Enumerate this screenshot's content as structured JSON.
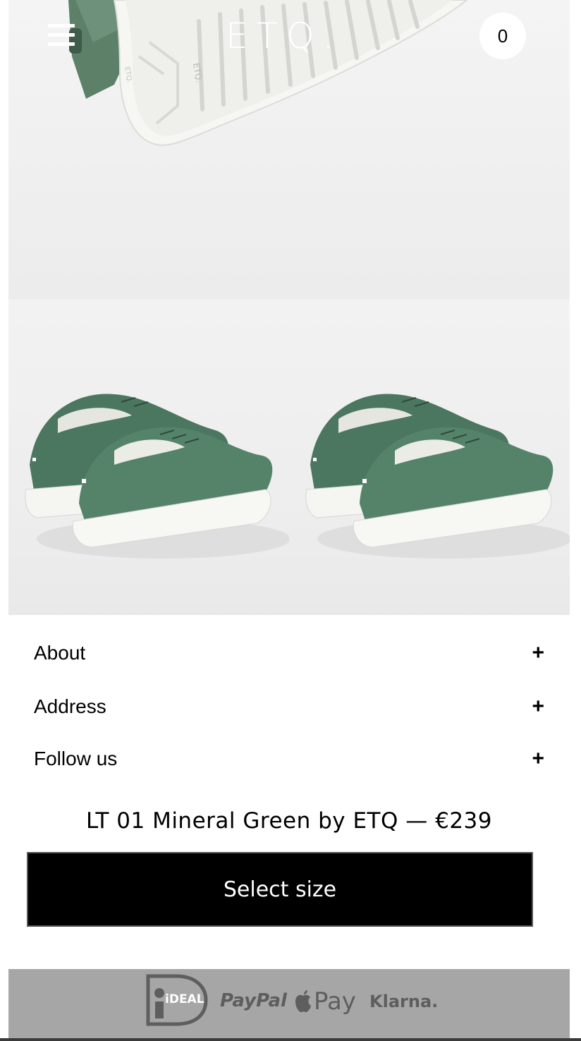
{
  "header": {
    "logo_text": "ETQ.",
    "cart_count": "0",
    "menu_icon": "hamburger-icon"
  },
  "gallery": {
    "hero_image": "shoe-sole-closeup",
    "thumbnails": [
      {
        "name": "green-sneakers-rear-view"
      },
      {
        "name": "green-sneakers-rear-view"
      }
    ]
  },
  "accordion": [
    {
      "label": "About",
      "icon": "+"
    },
    {
      "label": "Address",
      "icon": "+"
    },
    {
      "label": "Follow us",
      "icon": "+"
    }
  ],
  "product": {
    "line": "LT 01 Mineral Green by ETQ — €239",
    "button_label": "Select size"
  },
  "payments": {
    "ideal": "iDEAL",
    "paypal": "PayPal",
    "applepay": "Pay",
    "klarna": "Klarna."
  },
  "colors": {
    "shoe_green": "#4f7a5f",
    "sole_white": "#f7f7f5",
    "button_bg": "#000000",
    "payment_bar": "#a6a6a6"
  }
}
